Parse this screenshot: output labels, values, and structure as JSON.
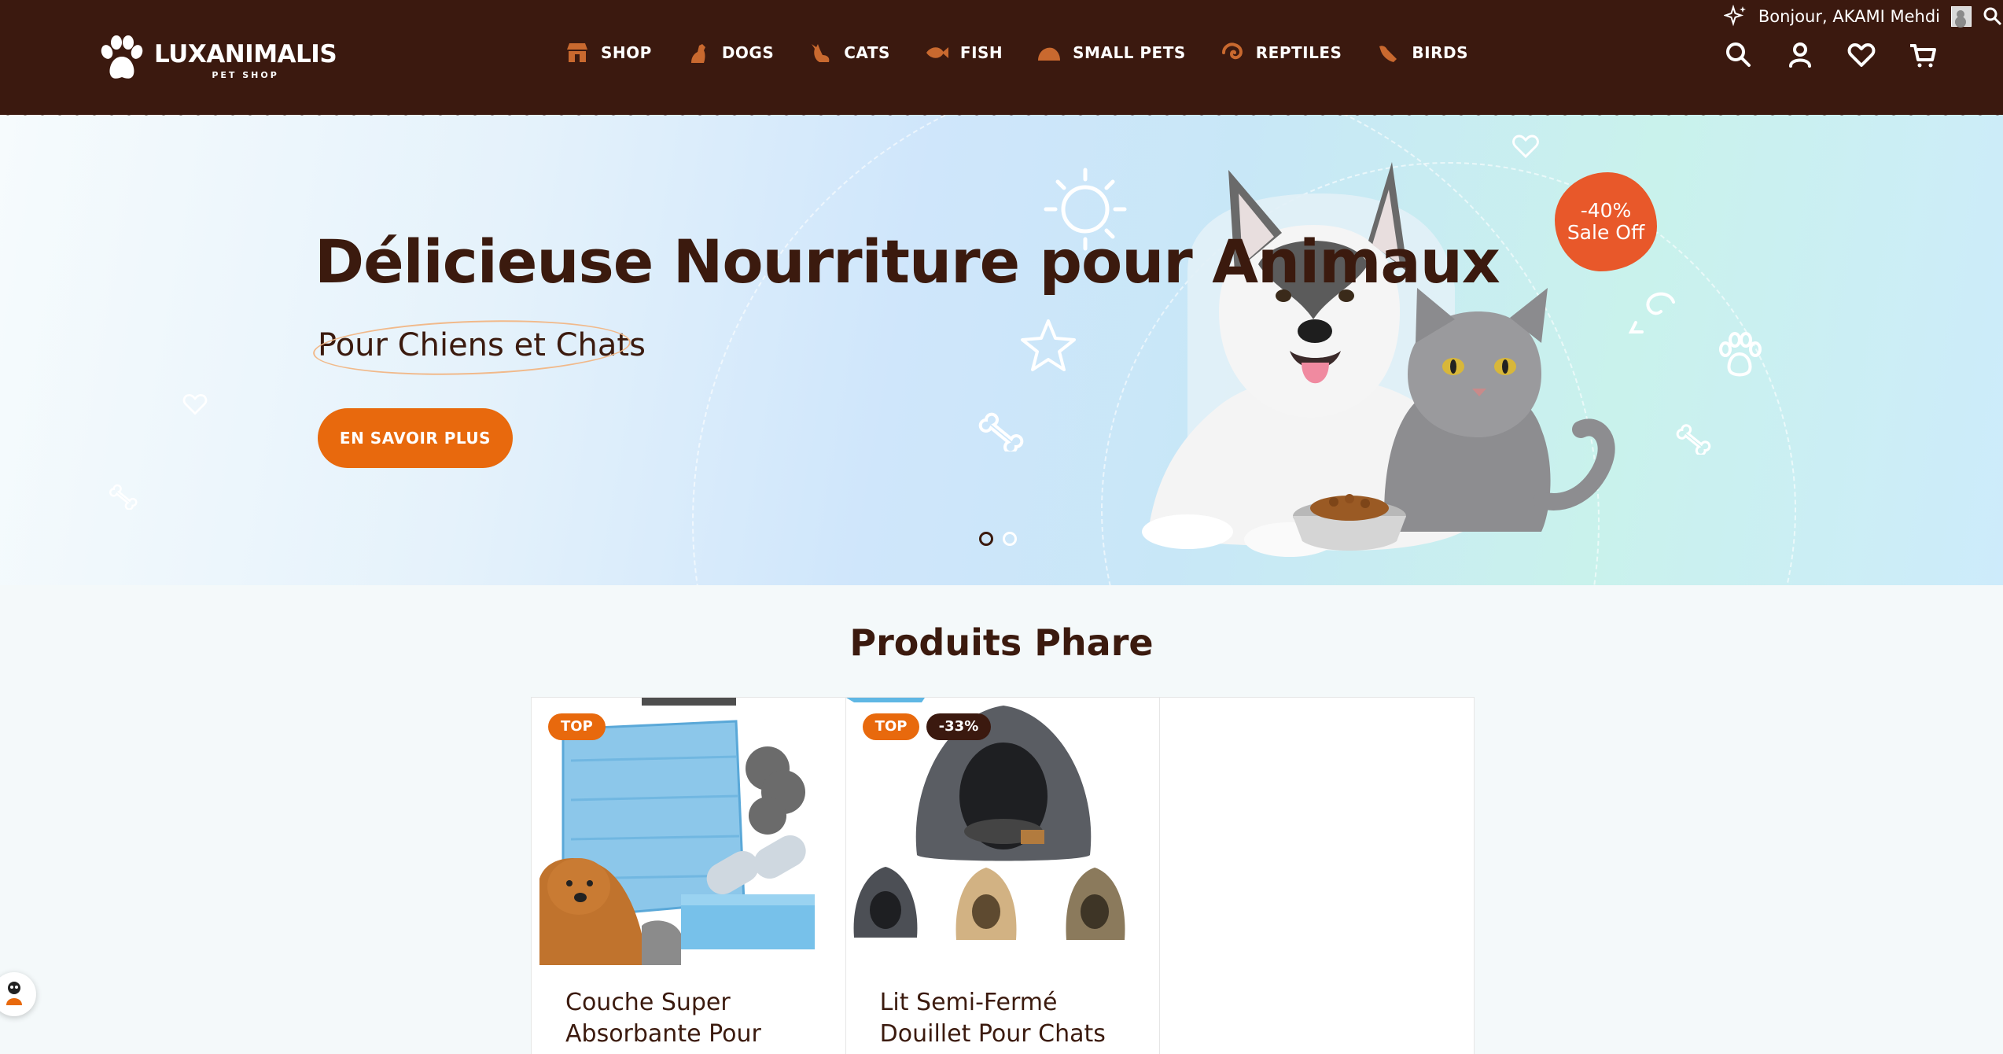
{
  "colors": {
    "header_bg": "#3b190f",
    "accent_orange": "#e8690d",
    "sale_badge": "#e8582a",
    "text_dark": "#3b1a0e"
  },
  "header": {
    "logo": {
      "name": "LUXANIMALIS",
      "sub": "PET SHOP",
      "icon": "paw-icon"
    },
    "greeting": "Bonjour, AKAMI Mehdi",
    "nav": [
      {
        "label": "SHOP",
        "icon": "store-icon"
      },
      {
        "label": "DOGS",
        "icon": "dog-icon"
      },
      {
        "label": "CATS",
        "icon": "cat-icon"
      },
      {
        "label": "FISH",
        "icon": "fish-icon"
      },
      {
        "label": "SMALL PETS",
        "icon": "small-pet-icon"
      },
      {
        "label": "REPTILES",
        "icon": "reptile-icon"
      },
      {
        "label": "BIRDS",
        "icon": "bird-icon"
      }
    ],
    "actions": [
      "search-icon",
      "account-icon",
      "heart-icon",
      "cart-icon"
    ]
  },
  "hero": {
    "title": "Délicieuse Nourriture pour Animaux",
    "subtitle": "Pour Chiens et Chats",
    "cta": "EN SAVOIR PLUS",
    "sale_badge": {
      "line1": "-40%",
      "line2": "Sale Off"
    },
    "slides": 2,
    "active_slide": 1
  },
  "featured": {
    "title": "Produits Phare",
    "products": [
      {
        "name": "Couche Super Absorbante Pour",
        "badges": [
          "TOP"
        ]
      },
      {
        "name": "Lit Semi-Fermé Douillet Pour Chats Et",
        "badges": [
          "TOP",
          "-33%"
        ]
      }
    ]
  }
}
